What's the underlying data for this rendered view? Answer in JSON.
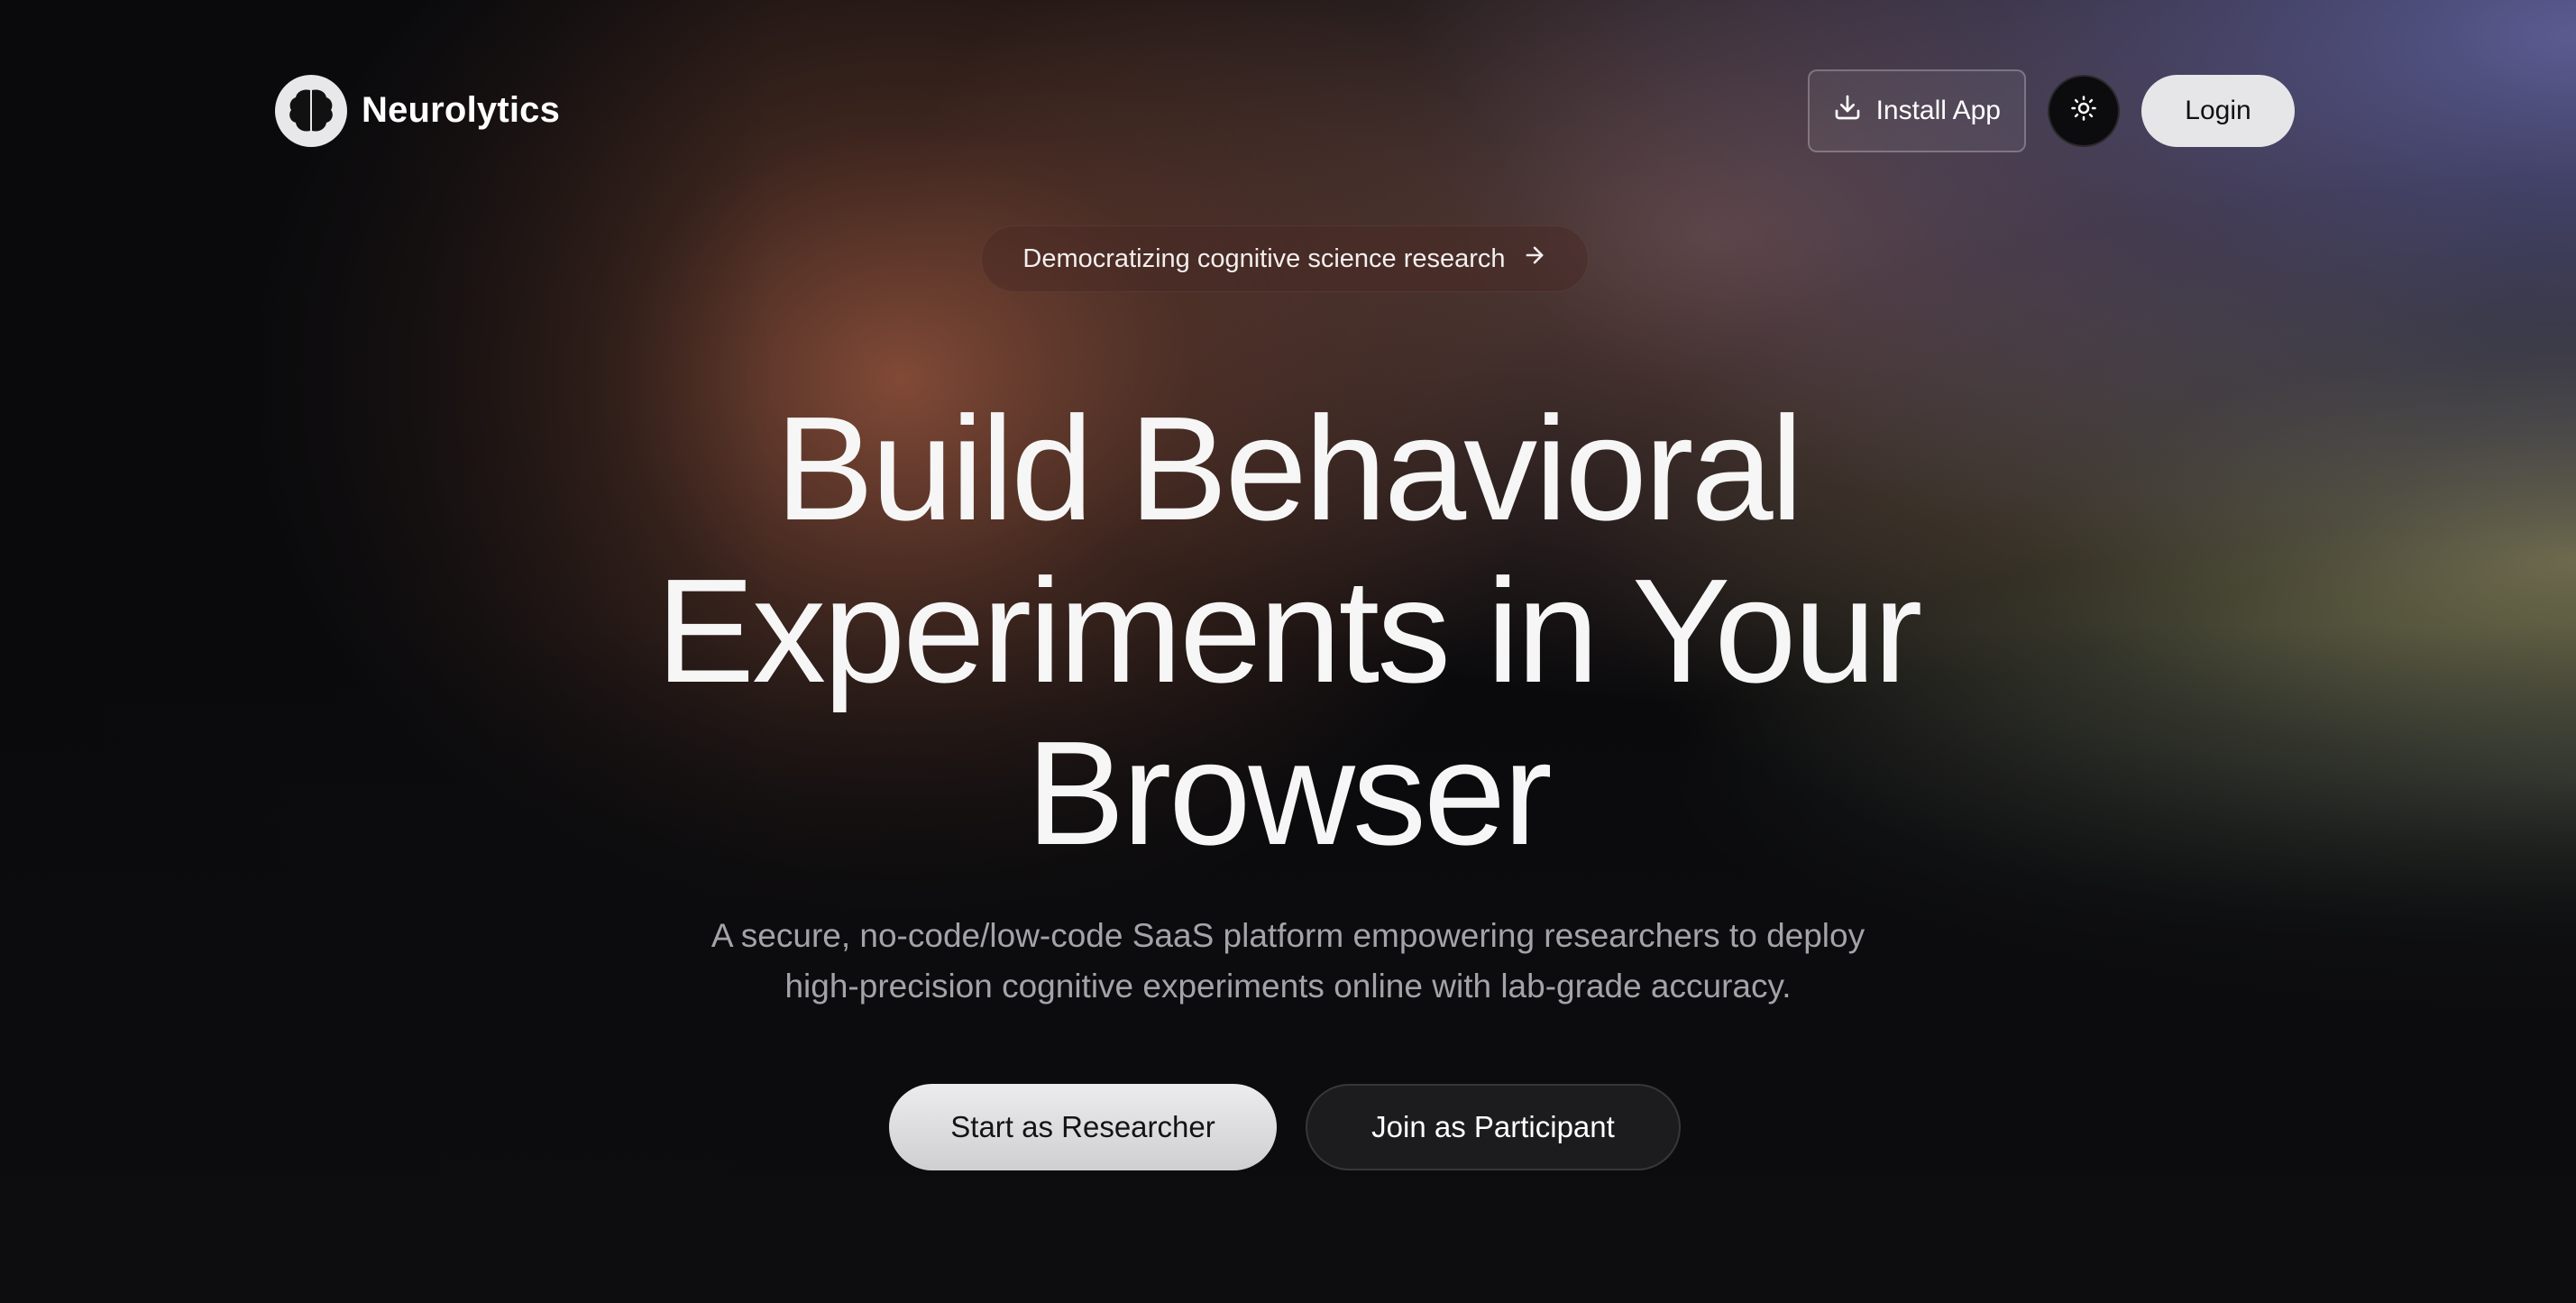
{
  "nav": {
    "brand_name": "Neurolytics",
    "logo_icon": "brain-icon",
    "install_label": "Install App",
    "install_icon": "download-icon",
    "theme_icon": "sun-icon",
    "login_label": "Login"
  },
  "badge": {
    "label": "Democratizing cognitive science research",
    "icon": "arrow-right-icon"
  },
  "hero": {
    "title_lines": [
      "Build Behavioral",
      "Experiments in Your",
      "Browser"
    ],
    "subtitle_lines": [
      "A secure, no-code/low-code SaaS platform empowering researchers to deploy",
      "high-precision cognitive experiments online with lab-grade accuracy."
    ],
    "primary_cta": "Start as Researcher",
    "secondary_cta": "Join as Participant"
  },
  "colors": {
    "background": "#0a0a0c",
    "button_light": "#e6e6e8",
    "text_muted": "#a3a3a8"
  }
}
